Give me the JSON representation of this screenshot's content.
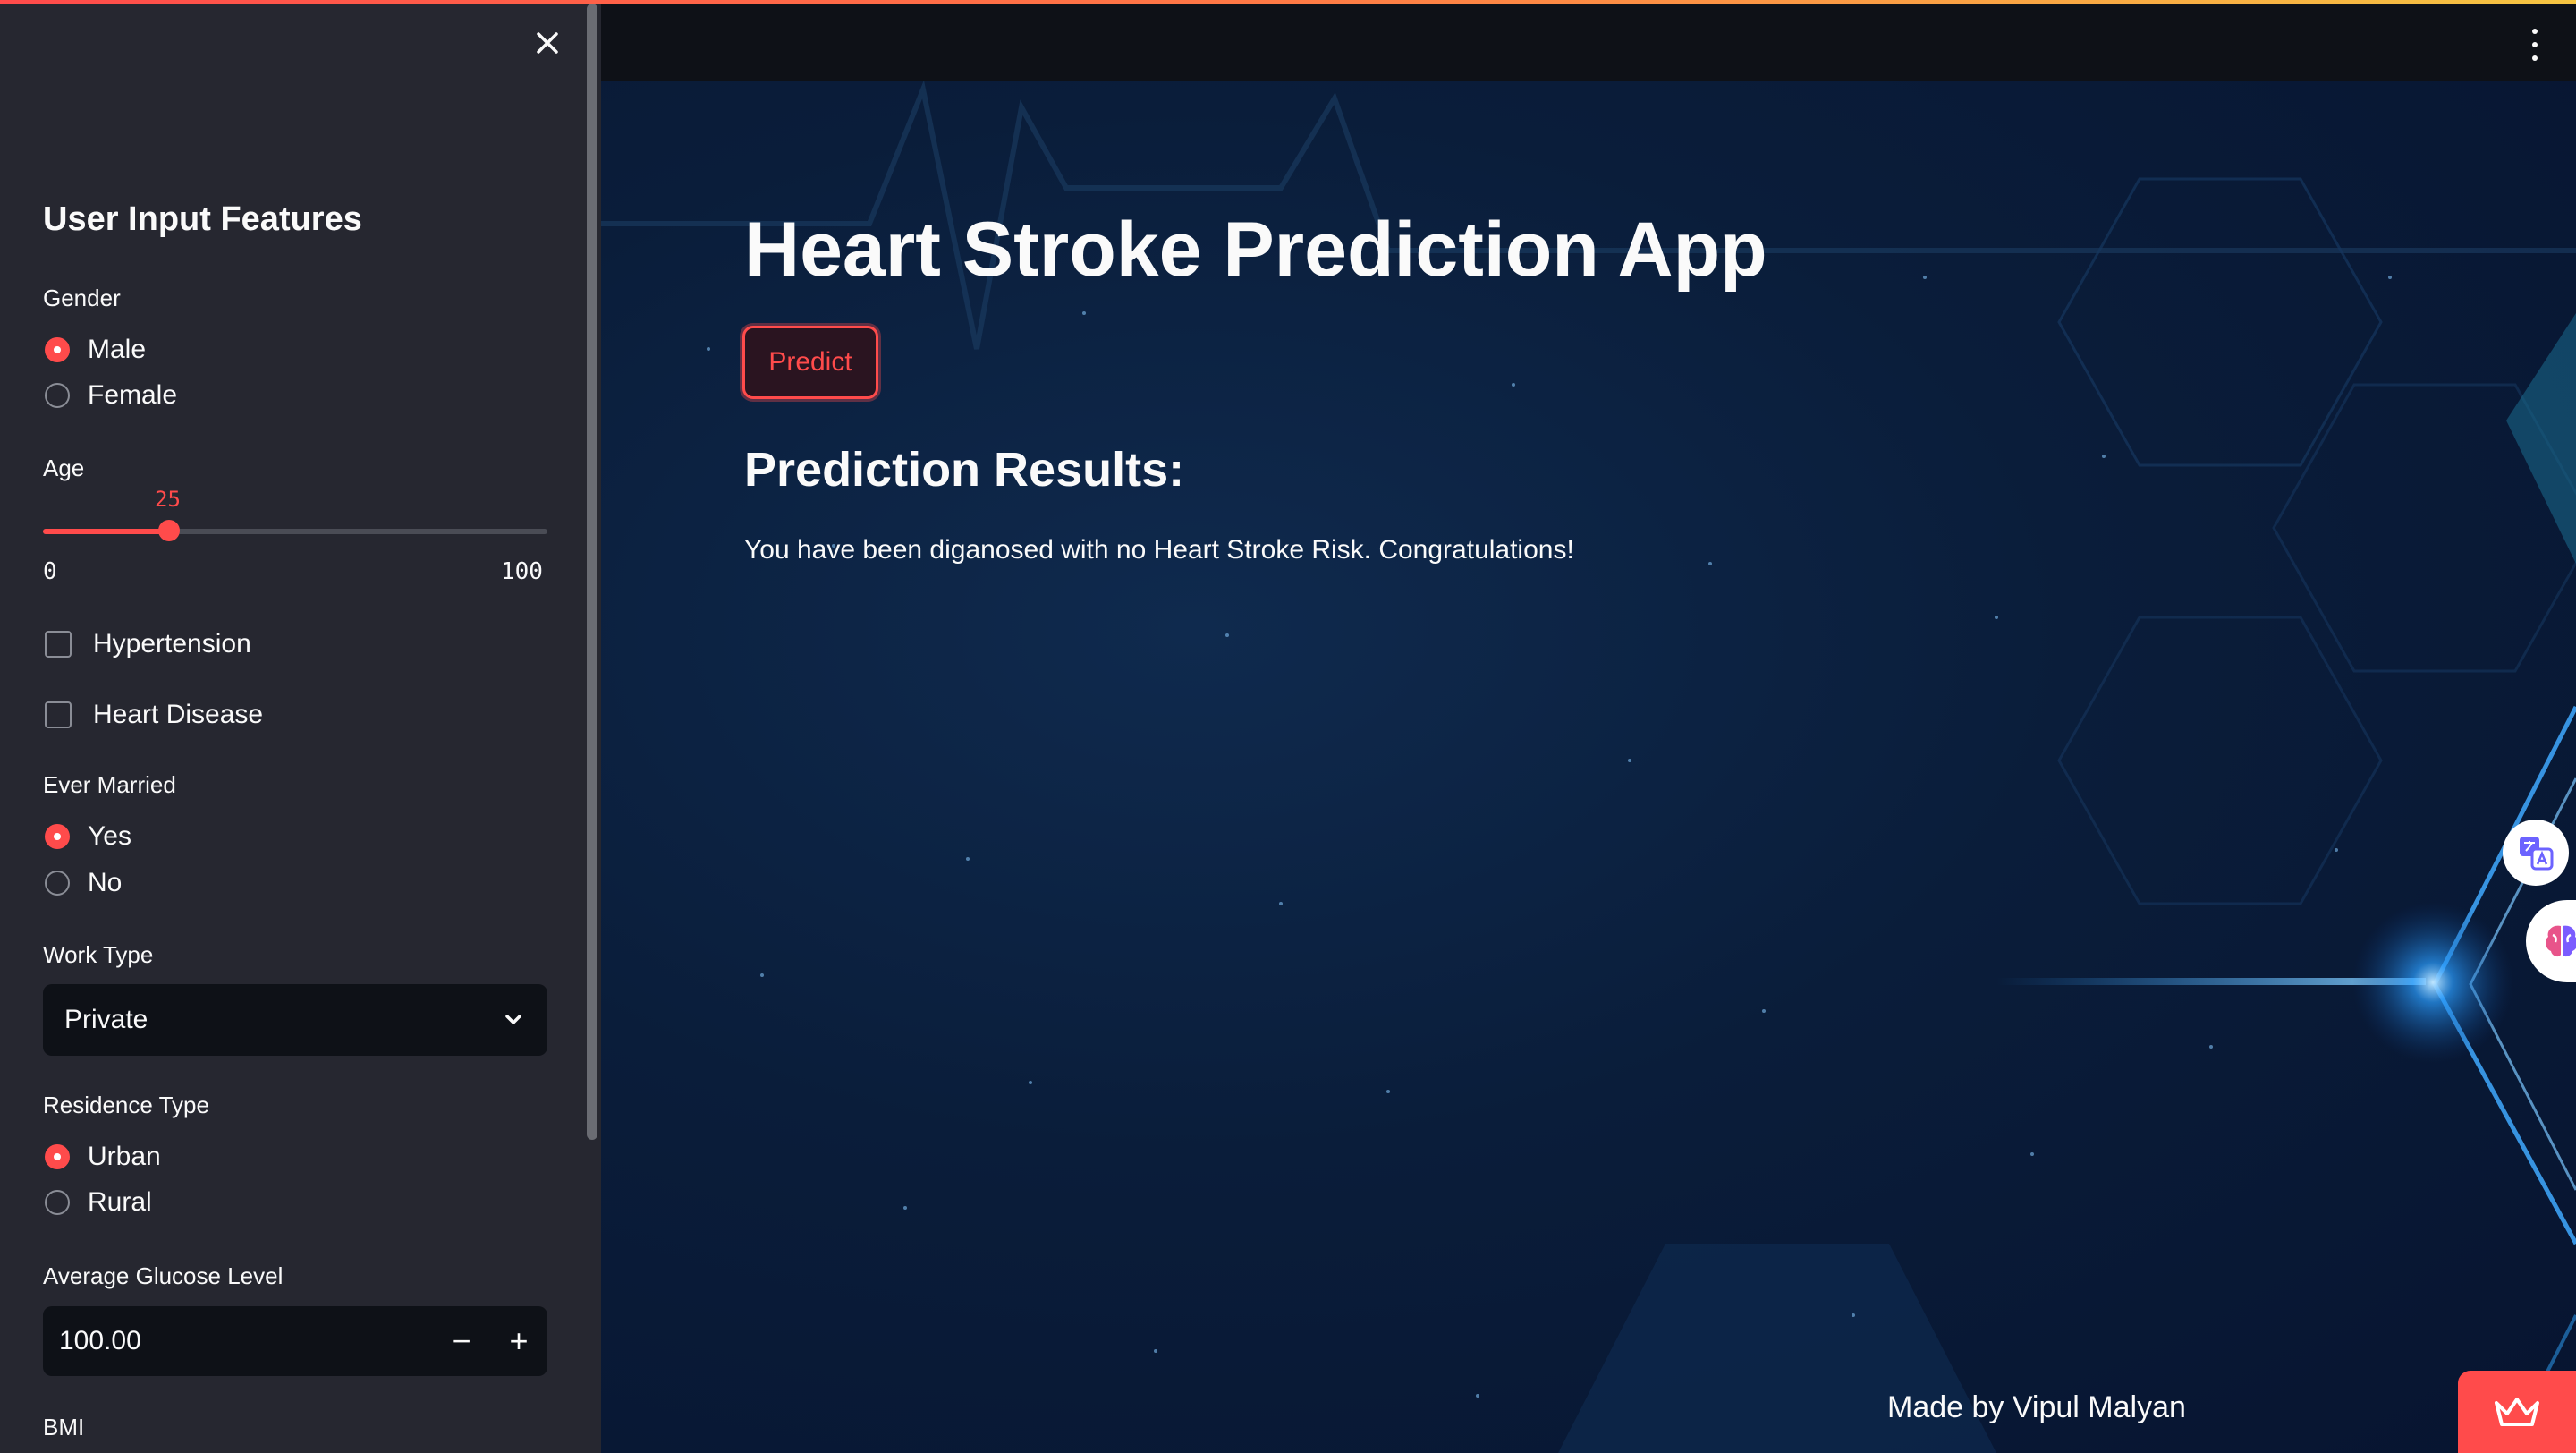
{
  "sidebar": {
    "title": "User Input Features",
    "gender": {
      "label": "Gender",
      "options": [
        "Male",
        "Female"
      ],
      "selected": "Male"
    },
    "age": {
      "label": "Age",
      "value": "25",
      "min": "0",
      "max": "100",
      "fraction": 0.25
    },
    "hypertension": {
      "label": "Hypertension",
      "checked": false
    },
    "heart_disease": {
      "label": "Heart Disease",
      "checked": false
    },
    "ever_married": {
      "label": "Ever Married",
      "options": [
        "Yes",
        "No"
      ],
      "selected": "Yes"
    },
    "work_type": {
      "label": "Work Type",
      "selected": "Private"
    },
    "residence_type": {
      "label": "Residence Type",
      "options": [
        "Urban",
        "Rural"
      ],
      "selected": "Urban"
    },
    "avg_glucose": {
      "label": "Average Glucose Level",
      "value": "100.00",
      "minus": "−",
      "plus": "+"
    },
    "bmi": {
      "label": "BMI"
    }
  },
  "main": {
    "title": "Heart Stroke Prediction App",
    "predict_label": "Predict",
    "results_heading": "Prediction Results:",
    "results_text": "You have been diganosed with no Heart Stroke Risk. Congratulations!",
    "footer": "Made by Vipul Malyan"
  },
  "icons": [
    "close-icon",
    "chevron-down-icon",
    "more-vertical-icon",
    "translate-icon",
    "brain-icon",
    "crown-icon"
  ],
  "colors": {
    "accent": "#ff4b4b",
    "sidebar_bg": "#262730",
    "topbar_bg": "#0e1117",
    "input_bg": "#0e1117"
  }
}
